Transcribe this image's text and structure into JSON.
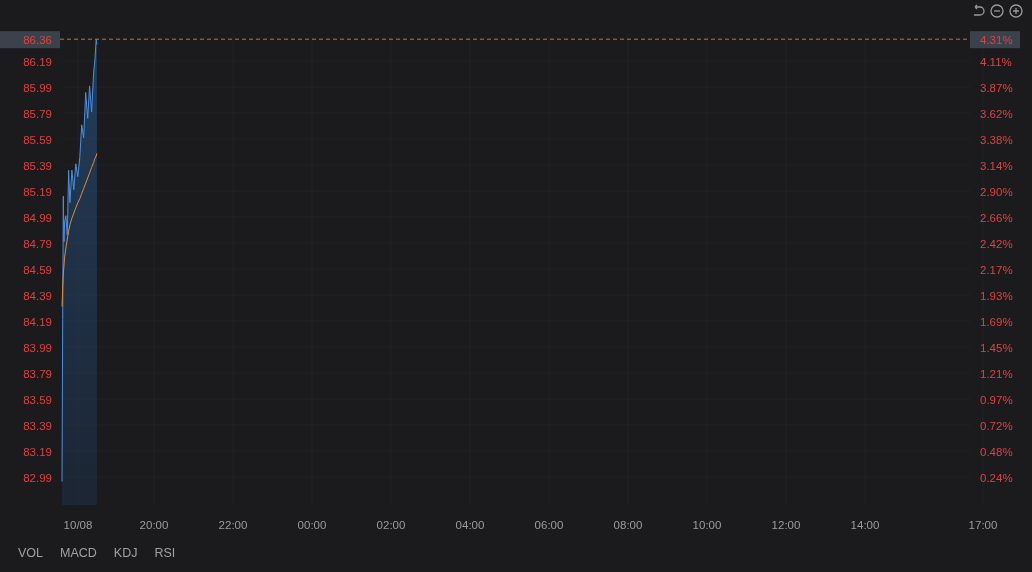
{
  "toolbar": {
    "buttons": [
      {
        "kind": "undo"
      },
      {
        "kind": "zoom_out"
      },
      {
        "kind": "zoom_in"
      }
    ]
  },
  "chart": {
    "price_tag": "86.36",
    "percent_tag": "4.31%",
    "price_axis": [
      "86.19",
      "85.99",
      "85.79",
      "85.59",
      "85.39",
      "85.19",
      "84.99",
      "84.79",
      "84.59",
      "84.39",
      "84.19",
      "83.99",
      "83.79",
      "83.59",
      "83.39",
      "83.19",
      "82.99"
    ],
    "percent_axis": [
      "4.11%",
      "3.87%",
      "3.62%",
      "3.38%",
      "3.14%",
      "2.90%",
      "2.66%",
      "2.42%",
      "2.17%",
      "1.93%",
      "1.69%",
      "1.45%",
      "1.21%",
      "0.97%",
      "0.72%",
      "0.48%",
      "0.24%"
    ],
    "time_axis": [
      "10/08",
      "20:00",
      "22:00",
      "00:00",
      "02:00",
      "04:00",
      "06:00",
      "08:00",
      "10:00",
      "12:00",
      "14:00",
      "17:00"
    ]
  },
  "indicators": [
    "VOL",
    "MACD",
    "KDJ",
    "RSI"
  ]
}
